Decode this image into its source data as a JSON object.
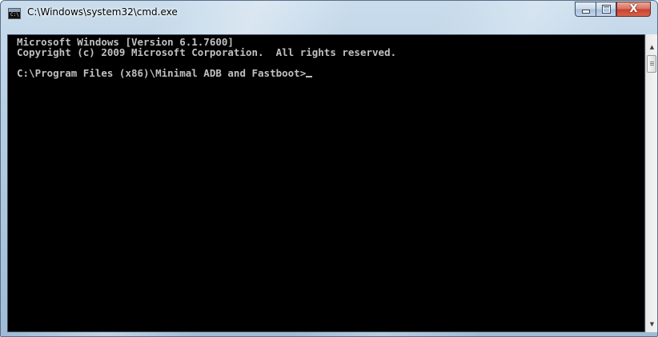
{
  "window": {
    "title": "C:\\Windows\\system32\\cmd.exe",
    "icon": "cmd-icon",
    "icon_text": "C:\\",
    "controls": {
      "minimize_icon": "minimize-icon",
      "maximize_icon": "maximize-icon",
      "close_icon": "close-icon",
      "close_glyph": "X"
    }
  },
  "console": {
    "lines": [
      "Microsoft Windows [Version 6.1.7600]",
      "Copyright (c) 2009 Microsoft Corporation.  All rights reserved.",
      "",
      "C:\\Program Files (x86)\\Minimal ADB and Fastboot>"
    ],
    "text_color": "#c0c0c0",
    "background_color": "#000000"
  },
  "scrollbar": {
    "up_arrow": "▲",
    "down_arrow": "▼"
  }
}
